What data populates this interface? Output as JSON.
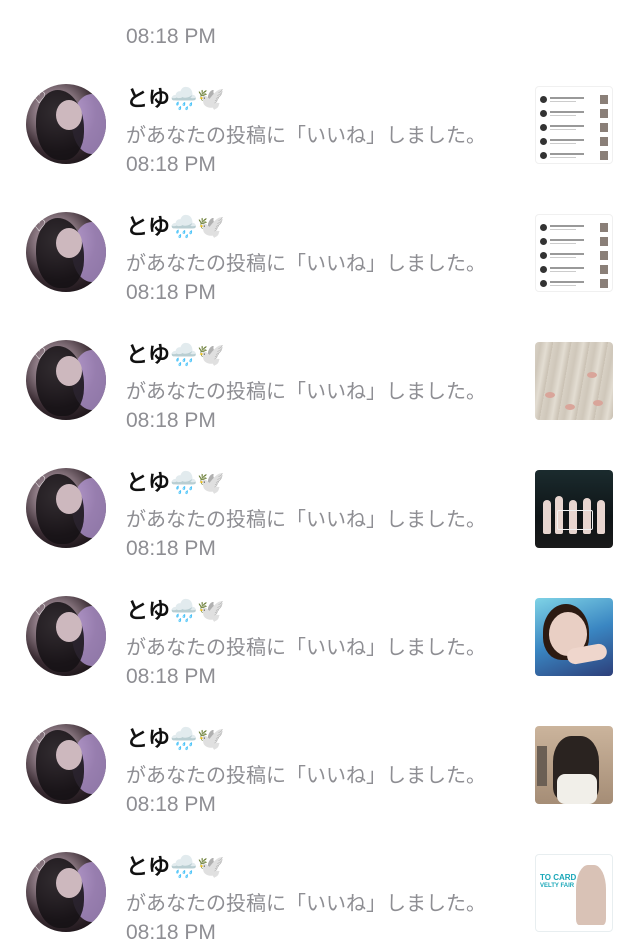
{
  "clipped_top_time": "08:18 PM",
  "notifications": [
    {
      "user": "とゆ🌧️🕊️",
      "message": "があなたの投稿に「いいね」しました。",
      "time": "08:18 PM",
      "thumbnail": "list-screenshot"
    },
    {
      "user": "とゆ🌧️🕊️",
      "message": "があなたの投稿に「いいね」しました。",
      "time": "08:18 PM",
      "thumbnail": "list-screenshot"
    },
    {
      "user": "とゆ🌧️🕊️",
      "message": "があなたの投稿に「いいね」しました。",
      "time": "08:18 PM",
      "thumbnail": "floor-photo"
    },
    {
      "user": "とゆ🌧️🕊️",
      "message": "があなたの投稿に「いいね」しました。",
      "time": "08:18 PM",
      "thumbnail": "stage-photo"
    },
    {
      "user": "とゆ🌧️🕊️",
      "message": "があなたの投稿に「いいね」しました。",
      "time": "08:18 PM",
      "thumbnail": "portrait-photo"
    },
    {
      "user": "とゆ🌧️🕊️",
      "message": "があなたの投稿に「いいね」しました。",
      "time": "08:18 PM",
      "thumbnail": "room-photo"
    },
    {
      "user": "とゆ🌧️🕊️",
      "message": "があなたの投稿に「いいね」しました。",
      "time": "08:18 PM",
      "thumbnail": "poster-photo"
    }
  ],
  "poster_text": {
    "line1": "TO CARD",
    "line2": "VELTY FAIR"
  },
  "colors": {
    "background": "#ffffff",
    "name_text": "#111111",
    "secondary_text": "#8e8e93"
  }
}
